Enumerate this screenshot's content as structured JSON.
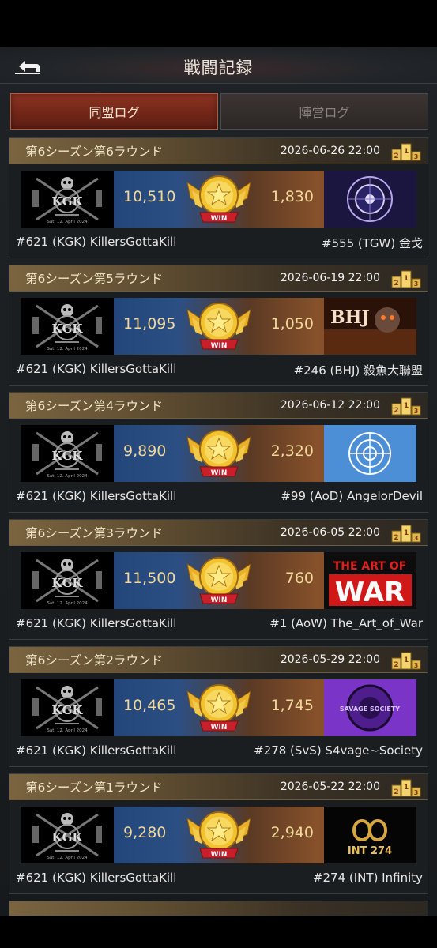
{
  "header": {
    "title": "戦闘記録"
  },
  "tabs": [
    {
      "label": "同盟ログ",
      "active": true
    },
    {
      "label": "陣営ログ",
      "active": false
    }
  ],
  "battles": [
    {
      "round": "第6シーズン第6ラウンド",
      "time": "2026-06-26 22:00",
      "our_score": "10,510",
      "enemy_score": "1,830",
      "result": "WIN",
      "our_name": "#621 (KGK) KillersGottaKill",
      "enemy_name": "#555 (TGW) 金戈",
      "enemy_logo": "violet-emblem"
    },
    {
      "round": "第6シーズン第5ラウンド",
      "time": "2026-06-19 22:00",
      "our_score": "11,095",
      "enemy_score": "1,050",
      "result": "WIN",
      "our_name": "#621 (KGK) KillersGottaKill",
      "enemy_name": "#246 (BHJ) 殺魚大聯盟",
      "enemy_logo": "BHJ"
    },
    {
      "round": "第6シーズン第4ラウンド",
      "time": "2026-06-12 22:00",
      "our_score": "9,890",
      "enemy_score": "2,320",
      "result": "WIN",
      "our_name": "#621 (KGK) KillersGottaKill",
      "enemy_name": "#99 (AoD) AngelorDevil",
      "enemy_logo": "un-emblem"
    },
    {
      "round": "第6シーズン第3ラウンド",
      "time": "2026-06-05 22:00",
      "our_score": "11,500",
      "enemy_score": "760",
      "result": "WIN",
      "our_name": "#621 (KGK) KillersGottaKill",
      "enemy_name": "#1 (AoW) The_Art_of_War",
      "enemy_logo": "THE ART OF WAR"
    },
    {
      "round": "第6シーズン第2ラウンド",
      "time": "2026-05-29 22:00",
      "our_score": "10,465",
      "enemy_score": "1,745",
      "result": "WIN",
      "our_name": "#621 (KGK) KillersGottaKill",
      "enemy_name": "#278 (SvS) S4vage~Society",
      "enemy_logo": "SAVAGE SOCIETY"
    },
    {
      "round": "第6シーズン第1ラウンド",
      "time": "2026-05-22 22:00",
      "our_score": "9,280",
      "enemy_score": "2,940",
      "result": "WIN",
      "our_name": "#621 (KGK) KillersGottaKill",
      "enemy_name": "#274 (INT) Infinity",
      "enemy_logo": "INT 274"
    }
  ],
  "our_logo": {
    "text": "KGK",
    "caption": "Sat. 12. April 2024"
  },
  "colors": {
    "accent_gold": "#f1d79a",
    "tab_active": "#8e3322",
    "blue_side": "#24477c",
    "orange_side": "#87512a"
  }
}
